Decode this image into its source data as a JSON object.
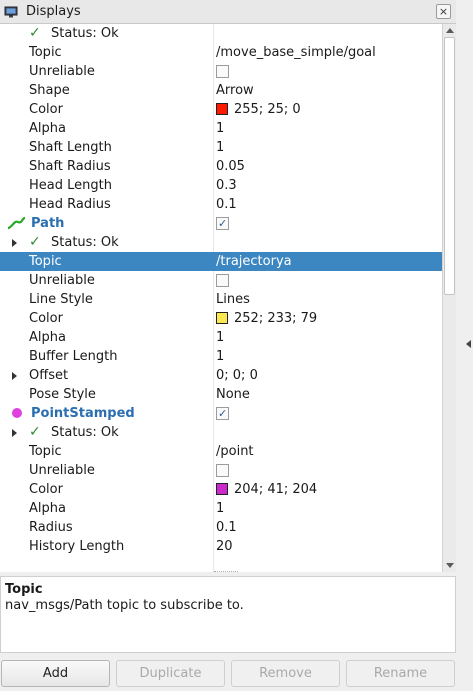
{
  "window": {
    "title": "Displays",
    "close_label": "×"
  },
  "tree": {
    "rows": [
      {
        "label": "Status: Ok",
        "value": "",
        "indent": 1,
        "check": true
      },
      {
        "label": "Topic",
        "value": "/move_base_simple/goal",
        "indent": 2
      },
      {
        "label": "Unreliable",
        "value": "",
        "indent": 2,
        "checkbox": false
      },
      {
        "label": "Shape",
        "value": "Arrow",
        "indent": 2
      },
      {
        "label": "Color",
        "value": "255; 25; 0",
        "indent": 2,
        "swatch": "#ff1900"
      },
      {
        "label": "Alpha",
        "value": "1",
        "indent": 2
      },
      {
        "label": "Shaft Length",
        "value": "1",
        "indent": 2
      },
      {
        "label": "Shaft Radius",
        "value": "0.05",
        "indent": 2
      },
      {
        "label": "Head Length",
        "value": "0.3",
        "indent": 2
      },
      {
        "label": "Head Radius",
        "value": "0.1",
        "indent": 2
      },
      {
        "label": "Path",
        "value": "",
        "indent": 0,
        "header": true,
        "icon": "path-icon",
        "checkbox": true,
        "expanded": true
      },
      {
        "label": "Status: Ok",
        "value": "",
        "indent": 1,
        "check": true,
        "arrow": true
      },
      {
        "label": "Topic",
        "value": "/trajectorya",
        "indent": 2,
        "selected": true
      },
      {
        "label": "Unreliable",
        "value": "",
        "indent": 2,
        "checkbox": false
      },
      {
        "label": "Line Style",
        "value": "Lines",
        "indent": 2
      },
      {
        "label": "Color",
        "value": "252; 233; 79",
        "indent": 2,
        "swatch": "#fce94f"
      },
      {
        "label": "Alpha",
        "value": "1",
        "indent": 2
      },
      {
        "label": "Buffer Length",
        "value": "1",
        "indent": 2
      },
      {
        "label": "Offset",
        "value": "0; 0; 0",
        "indent": 2,
        "arrow": true
      },
      {
        "label": "Pose Style",
        "value": "None",
        "indent": 2
      },
      {
        "label": "PointStamped",
        "value": "",
        "indent": 0,
        "header": true,
        "icon": "point-stamped-icon",
        "checkbox": true
      },
      {
        "label": "Status: Ok",
        "value": "",
        "indent": 1,
        "check": true,
        "arrow": true
      },
      {
        "label": "Topic",
        "value": "/point",
        "indent": 2
      },
      {
        "label": "Unreliable",
        "value": "",
        "indent": 2,
        "checkbox": false
      },
      {
        "label": "Color",
        "value": "204; 41; 204",
        "indent": 2,
        "swatch": "#cc29cc"
      },
      {
        "label": "Alpha",
        "value": "1",
        "indent": 2
      },
      {
        "label": "Radius",
        "value": "0.1",
        "indent": 2
      },
      {
        "label": "History Length",
        "value": "20",
        "indent": 2
      }
    ]
  },
  "description": {
    "title": "Topic",
    "text": "nav_msgs/Path topic to subscribe to."
  },
  "buttons": {
    "add": "Add",
    "duplicate": "Duplicate",
    "remove": "Remove",
    "rename": "Rename"
  },
  "colors": {
    "selection": "#3c87c2",
    "header_text": "#2b6fb0",
    "status_ok": "#2f8a2f"
  }
}
